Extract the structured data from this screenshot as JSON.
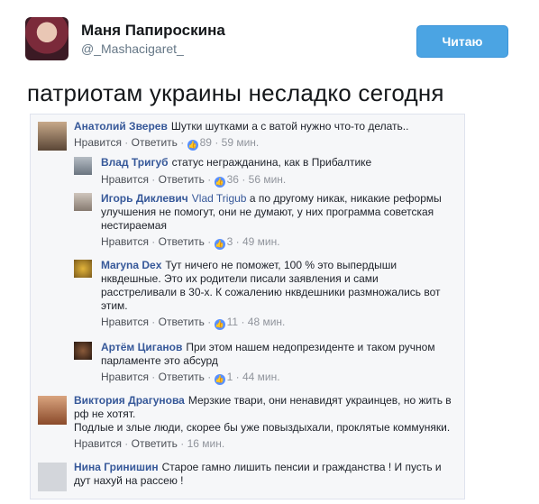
{
  "tweet": {
    "name": "Маня Папироскина",
    "handle": "@_Mashacigaret_",
    "follow_label": "Читаю",
    "text": "патриотам украины несладко сегодня"
  },
  "labels": {
    "like": "Нравится",
    "reply": "Ответить",
    "dot": "·"
  },
  "comments": [
    {
      "author": "Анатолий Зверев",
      "text": "Шутки шутками а с ватой нужно что-то делать..",
      "likes": "89",
      "time": "59 мин."
    },
    {
      "author": "Влад Тригуб",
      "text": "статус негражданина, как в Прибалтике",
      "likes": "36",
      "time": "56 мин."
    },
    {
      "author": "Игорь Диклевич",
      "mention": "Vlad Trigub",
      "text": "а по другому никак, никакие реформы",
      "text2": "улучшения не помогут, они не думают, у них программа советская",
      "text3": "нестираемая",
      "likes": "3",
      "time": "49 мин."
    },
    {
      "author": "Maryna Dex",
      "text": "Тут ничего не поможет, 100 % это выпердыши",
      "text2": "нквдешные. Это их родители писали заявления и сами",
      "text3": "расстреливали в 30-х. К сожалению нквдешники размножались вот",
      "text4": "этим.",
      "likes": "11",
      "time": "48 мин."
    },
    {
      "author": "Артём Циганов",
      "text": "При этом нашем недопрезиденте и таком ручном",
      "text2": "парламенте это абсурд",
      "likes": "1",
      "time": "44 мин."
    },
    {
      "author": "Виктория Драгунова",
      "text": "Мерзкие твари, они ненавидят украинцев, но жить в",
      "text2": "рф не хотят.",
      "text3": "Подлые и злые люди, скорее бы уже повыздыхали, проклятые коммуняки.",
      "time": "16 мин."
    },
    {
      "author": "Нина Гринишин",
      "text": "Старое гамно лишить пенсии и гражданства ! И пусть и",
      "text2": "дут нахуй на рассею !"
    }
  ]
}
